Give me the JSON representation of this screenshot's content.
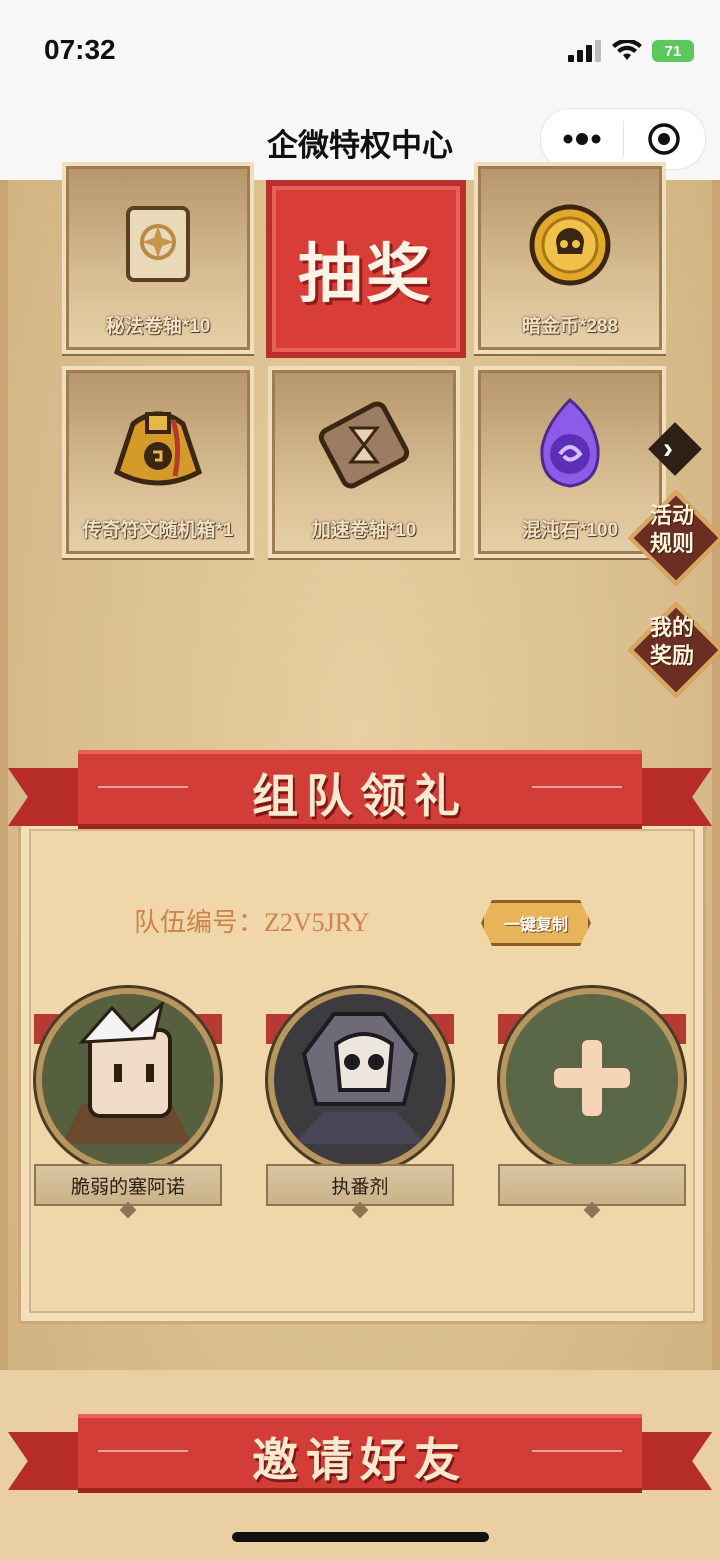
{
  "status_bar": {
    "time": "07:32",
    "battery": "71"
  },
  "nav": {
    "title": "企微特权中心"
  },
  "prizes": [
    {
      "label": "秘法卷轴*10",
      "icon": "scroll-icon"
    },
    {
      "label": "暗金币*288",
      "icon": "skull-coin-icon"
    },
    {
      "label": "传奇符文随机箱*1",
      "icon": "rune-bag-icon"
    },
    {
      "label": "加速卷轴*10",
      "icon": "hourglass-scroll-icon"
    },
    {
      "label": "混沌石*100",
      "icon": "chaos-stone-icon"
    }
  ],
  "draw_button": {
    "label": "抽奖"
  },
  "side_buttons": {
    "rules": "活动\n规则",
    "my_rewards": "我的\n奖励"
  },
  "team_section": {
    "title": "组队领礼",
    "team_id_label": "队伍编号：Z2V5JRY",
    "copy_button": "一键复制",
    "members": [
      {
        "name": "脆弱的塞阿诺"
      },
      {
        "name": "执番剂"
      },
      {
        "name": ""
      }
    ]
  },
  "invite_section": {
    "title": "邀请好友"
  },
  "colors": {
    "accent_red": "#d23d37",
    "parchment": "#efd7a9",
    "team_id_text": "#d0824a"
  }
}
